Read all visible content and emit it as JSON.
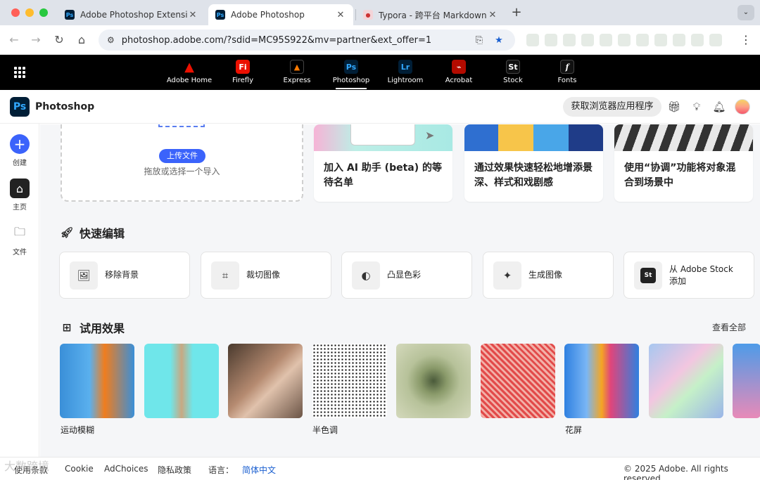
{
  "browser": {
    "tabs": [
      {
        "title": "Adobe Photoshop Extension",
        "favicon": "Ps",
        "active": false
      },
      {
        "title": "Adobe Photoshop",
        "favicon": "Ps",
        "active": true
      },
      {
        "title": "Typora - 跨平台 Markdown 编",
        "favicon": "typora-icon",
        "active": false
      }
    ],
    "new_tab": "+",
    "url": "photoshop.adobe.com/?sdid=MC95S922&mv=partner&ext_offer=1"
  },
  "appbar": {
    "apps": [
      {
        "label": "Adobe Home",
        "glyph": "A",
        "color": "#eb1000"
      },
      {
        "label": "Firefly",
        "glyph": "Fi",
        "color": "#eb1000"
      },
      {
        "label": "Express",
        "glyph": "A",
        "color": "#7b2cff"
      },
      {
        "label": "Photoshop",
        "glyph": "Ps",
        "color": "#31a8ff"
      },
      {
        "label": "Lightroom",
        "glyph": "Lr",
        "color": "#31a8ff"
      },
      {
        "label": "Acrobat",
        "glyph": "A",
        "color": "#b30b00"
      },
      {
        "label": "Stock",
        "glyph": "St",
        "color": "#ffffff"
      },
      {
        "label": "Fonts",
        "glyph": "f",
        "color": "#ffffff"
      }
    ],
    "active": "Photoshop"
  },
  "header": {
    "logo": "Ps",
    "app_name": "Photoshop",
    "get_app_label": "获取浏览器应用程序"
  },
  "rail": {
    "create": "创建",
    "home": "主页",
    "files": "文件"
  },
  "upload": {
    "button": "上传文件",
    "hint": "拖放或选择一个导入"
  },
  "promos": [
    {
      "text": "加入 AI 助手 (beta) 的等待名单"
    },
    {
      "text": "通过效果快速轻松地增添景深、样式和戏剧感"
    },
    {
      "text": "使用“协调”功能将对象混合到场景中"
    }
  ],
  "quick_edit": {
    "title": "快速编辑",
    "items": [
      {
        "label": "移除背景",
        "icon": "image-icon"
      },
      {
        "label": "裁切图像",
        "icon": "crop-icon"
      },
      {
        "label": "凸显色彩",
        "icon": "color-icon"
      },
      {
        "label": "生成图像",
        "icon": "generate-image-icon"
      },
      {
        "label": "从 Adobe Stock 添加",
        "icon": "stock-icon",
        "glyph": "St"
      }
    ]
  },
  "effects": {
    "title": "试用效果",
    "view_all": "查看全部",
    "labels": [
      "运动模糊",
      "半色调",
      "花屏"
    ]
  },
  "footer": {
    "terms": "使用条款",
    "cookie": "Cookie",
    "adchoices": "AdChoices",
    "privacy": "隐私政策",
    "language_label": "语言：",
    "language": "简体中文",
    "copyright": "© 2025 Adobe. All rights reserved.",
    "watermark": "大数跨境"
  }
}
